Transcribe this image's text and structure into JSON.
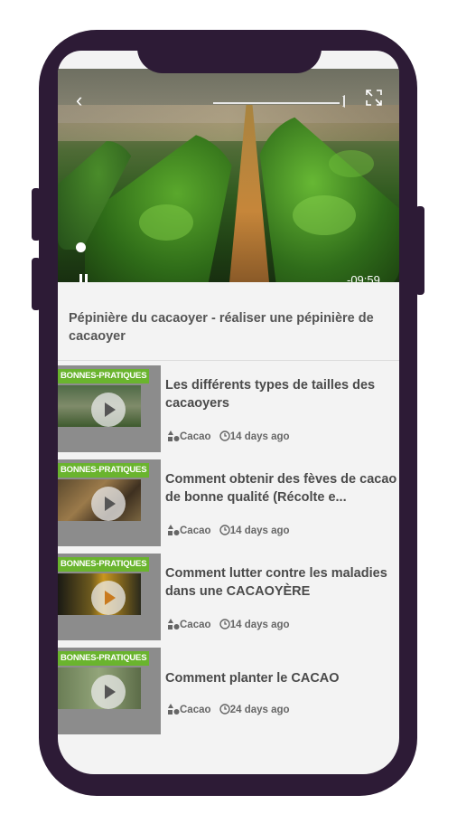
{
  "video": {
    "duration": "-09:59",
    "title": "Pépinière du cacaoyer - réaliser une pépinière de cacaoyer"
  },
  "items": [
    {
      "badge": "BONNES-PRATIQUES",
      "title": "Les différents types de tailles des cacaoyers",
      "category": "Cacao",
      "age": "14 days ago"
    },
    {
      "badge": "BONNES-PRATIQUES",
      "title": "Comment obtenir des fèves de cacao de bonne qualité (Récolte e...",
      "category": "Cacao",
      "age": "14 days ago"
    },
    {
      "badge": "BONNES-PRATIQUES",
      "title": "Comment lutter contre les maladies dans une CACAOYÈRE",
      "category": "Cacao",
      "age": "14 days ago"
    },
    {
      "badge": "BONNES-PRATIQUES",
      "title": "Comment planter le CACAO",
      "category": "Cacao",
      "age": "24 days ago"
    }
  ],
  "icons": {
    "back": "chevron-left-icon",
    "fullscreen": "expand-icon",
    "pause": "pause-icon",
    "play": "play-icon",
    "category": "shapes-icon",
    "time": "clock-icon"
  },
  "colors": {
    "phone_frame": "#2d1b36",
    "badge": "#6ab42e",
    "background": "#f3f3f3"
  }
}
